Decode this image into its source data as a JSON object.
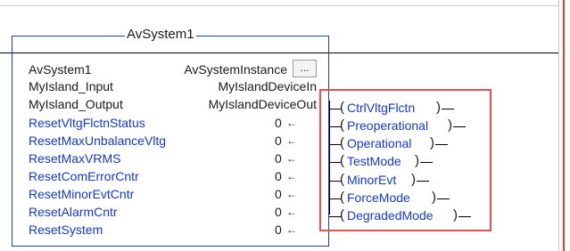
{
  "aoi": {
    "title": "AvSystem1",
    "params": [
      {
        "name": "AvSystem1",
        "value": "AvSystemInstance",
        "blue": false
      },
      {
        "name": "MyIsland_Input",
        "value": "MyIslandDeviceIn",
        "blue": false
      },
      {
        "name": "MyIsland_Output",
        "value": "MyIslandDeviceOut",
        "blue": false
      },
      {
        "name": "ResetVltgFlctnStatus",
        "value": "0",
        "blue": true
      },
      {
        "name": "ResetMaxUnbalanceVltg",
        "value": "0",
        "blue": true
      },
      {
        "name": "ResetMaxVRMS",
        "value": "0",
        "blue": true
      },
      {
        "name": "ResetComErrorCntr",
        "value": "0",
        "blue": true
      },
      {
        "name": "ResetMinorEvtCntr",
        "value": "0",
        "blue": true
      },
      {
        "name": "ResetAlarmCntr",
        "value": "0",
        "blue": true
      },
      {
        "name": "ResetSystem",
        "value": "0",
        "blue": true
      }
    ],
    "ellipsis_label": "...",
    "arrow_glyph": "←"
  },
  "coils": [
    "CtrlVltgFlctn",
    "Preoperational",
    "Operational",
    "TestMode",
    "MinorEvt",
    "ForceMode",
    "DegradedMode"
  ],
  "colors": {
    "tag_blue": "#1439c9",
    "highlight": "#e05050",
    "block_border": "#1f3fb0"
  }
}
